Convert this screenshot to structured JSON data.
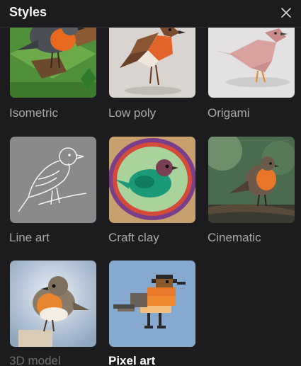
{
  "header": {
    "title": "Styles",
    "close_icon": "close-icon"
  },
  "styles": [
    {
      "label": "Isometric",
      "selected": false
    },
    {
      "label": "Low poly",
      "selected": false
    },
    {
      "label": "Origami",
      "selected": false
    },
    {
      "label": "Line art",
      "selected": false
    },
    {
      "label": "Craft clay",
      "selected": false
    },
    {
      "label": "Cinematic",
      "selected": false
    },
    {
      "label": "3D model",
      "selected": false
    },
    {
      "label": "Pixel art",
      "selected": true
    }
  ],
  "colors": {
    "background": "#1c1c1e",
    "label": "#a9a9ad",
    "selected_label": "#ffffff",
    "selected_border": "#cfd8e3"
  }
}
